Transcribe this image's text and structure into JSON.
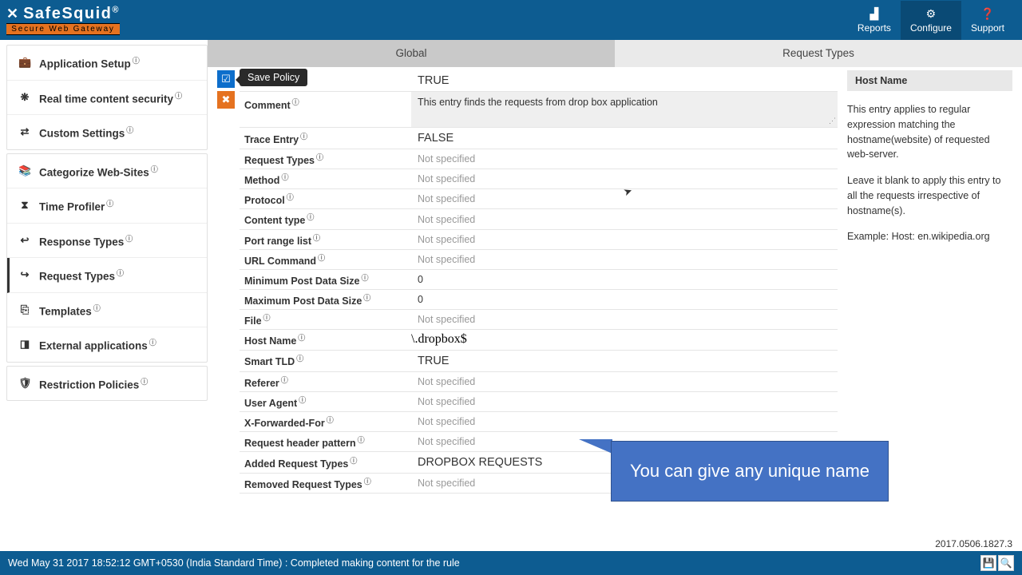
{
  "brand": {
    "name": "SafeSquid",
    "reg": "®",
    "tagline": "Secure Web Gateway"
  },
  "nav": {
    "reports": "Reports",
    "configure": "Configure",
    "support": "Support"
  },
  "sidebar": {
    "g1": [
      {
        "icon": "💼",
        "label": "Application Setup"
      },
      {
        "icon": "❋",
        "label": "Real time content security"
      },
      {
        "icon": "⇄",
        "label": "Custom Settings"
      }
    ],
    "g2": [
      {
        "icon": "📚",
        "label": "Categorize Web-Sites"
      },
      {
        "icon": "⧗",
        "label": "Time Profiler"
      },
      {
        "icon": "↩",
        "label": "Response Types"
      },
      {
        "icon": "↪",
        "label": "Request Types"
      },
      {
        "icon": "⎘",
        "label": "Templates"
      },
      {
        "icon": "◨",
        "label": "External applications"
      }
    ],
    "g3": [
      {
        "icon": "🛡",
        "label": "Restriction Policies"
      }
    ]
  },
  "tabs": {
    "global": "Global",
    "reqtypes": "Request Types"
  },
  "tooltip": "Save Policy",
  "form": {
    "enabled": "TRUE",
    "comment_lbl": "Comment",
    "comment": "This entry finds the requests from drop box application",
    "trace_lbl": "Trace Entry",
    "trace": "FALSE",
    "reqtypes_lbl": "Request Types",
    "method_lbl": "Method",
    "protocol_lbl": "Protocol",
    "ctype_lbl": "Content type",
    "portrange_lbl": "Port range list",
    "urlcmd_lbl": "URL Command",
    "minpost_lbl": "Minimum Post Data Size",
    "minpost": "0",
    "maxpost_lbl": "Maximum Post Data Size",
    "maxpost": "0",
    "file_lbl": "File",
    "host_lbl": "Host Name",
    "host": "\\.dropbox$",
    "tld_lbl": "Smart TLD",
    "tld": "TRUE",
    "referer_lbl": "Referer",
    "ua_lbl": "User Agent",
    "xff_lbl": "X-Forwarded-For",
    "rhp_lbl": "Request header pattern",
    "added_lbl": "Added Request Types",
    "added": "DROPBOX REQUESTS",
    "removed_lbl": "Removed Request Types",
    "ns": "Not specified"
  },
  "help": {
    "title": "Host Name",
    "p1": "This entry applies to regular expression matching the hostname(website) of requested web-server.",
    "p2": "Leave it blank to apply this entry to all the requests irrespective of hostname(s).",
    "p3": "Example: Host: en.wikipedia.org"
  },
  "callout": "You can give any unique name",
  "footer": {
    "status": "Wed May 31 2017 18:52:12 GMT+0530 (India Standard Time) : Completed making content for the rule",
    "version": "2017.0506.1827.3"
  }
}
